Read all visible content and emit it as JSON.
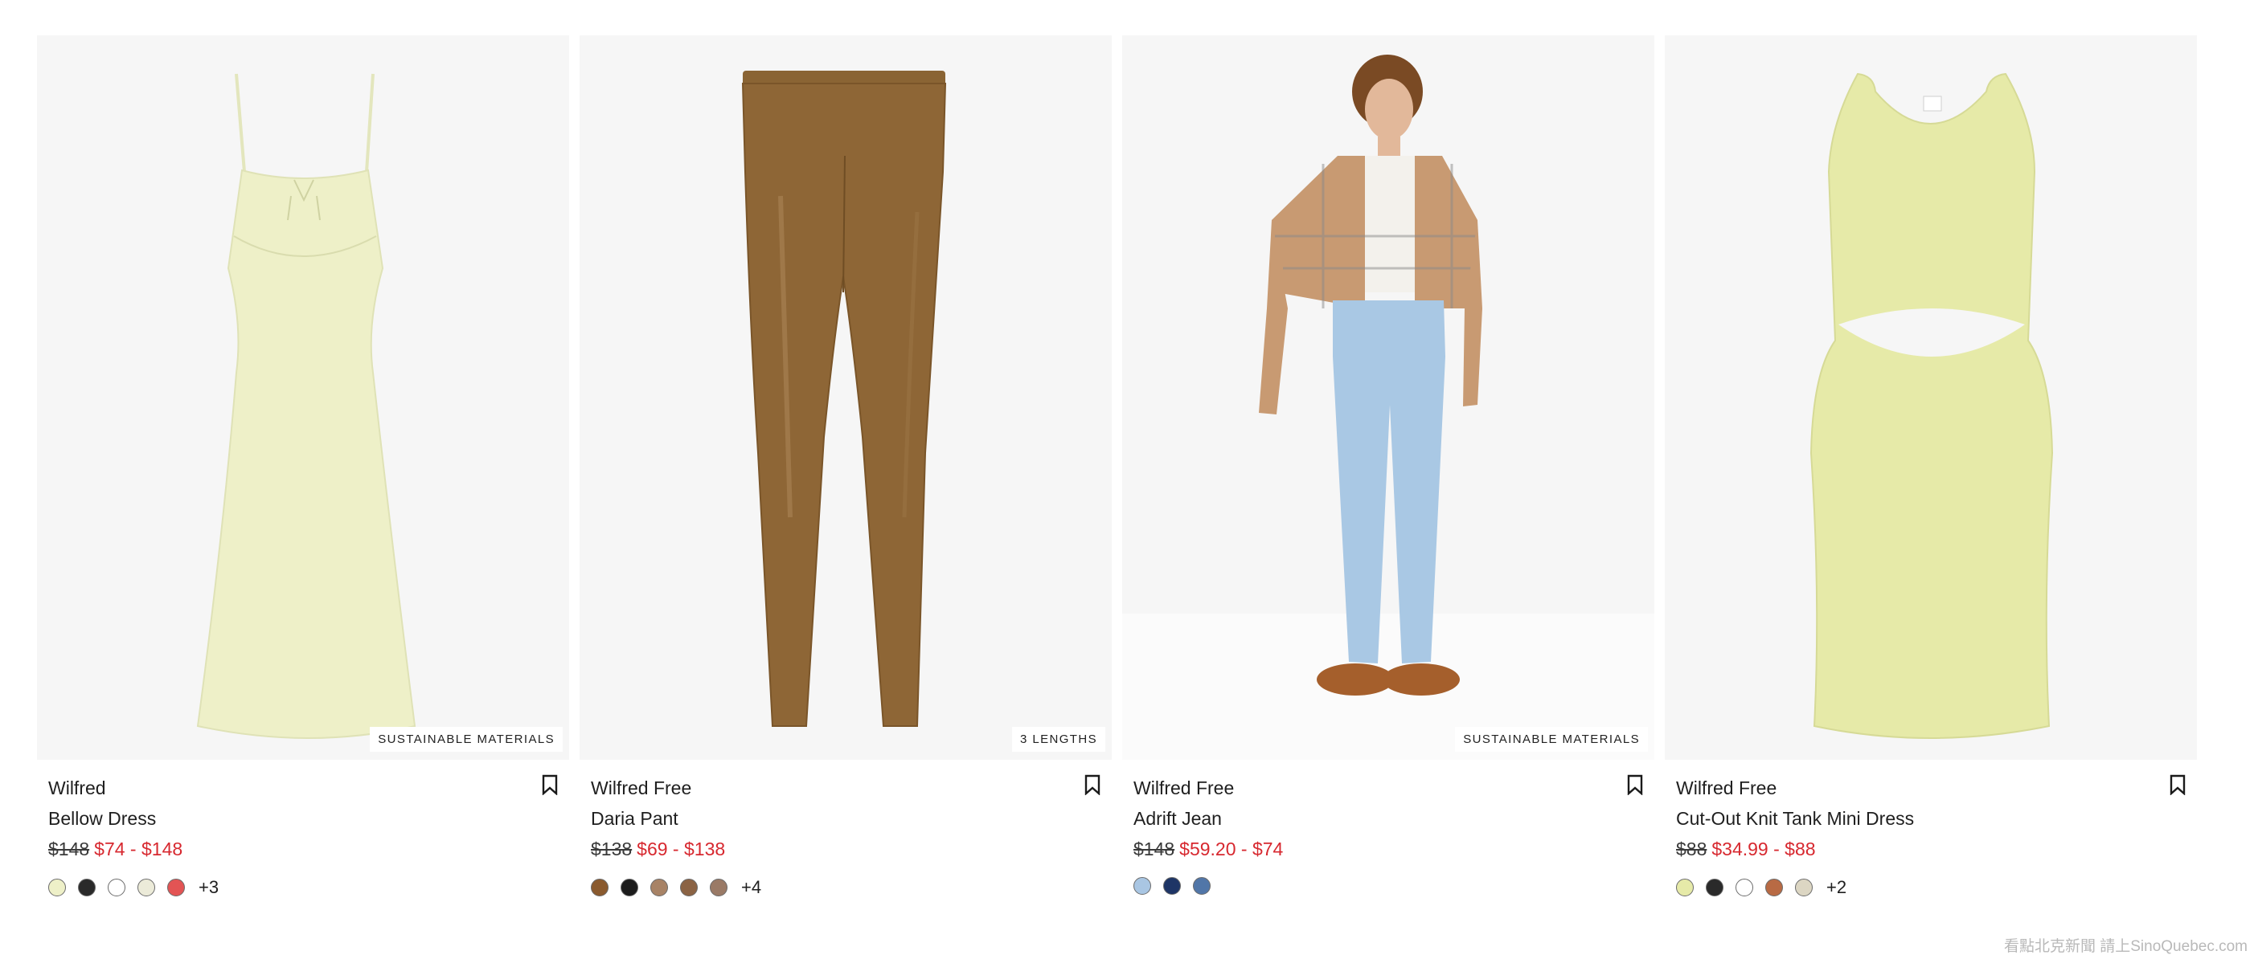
{
  "products": [
    {
      "brand": "Wilfred",
      "name": "Bellow Dress",
      "price_original": "$148",
      "price_sale": "$74 - $148",
      "badge": "SUSTAINABLE MATERIALS",
      "swatches": [
        "#eef0c8",
        "#2a2a2a",
        "#ffffff",
        "#ecebd9",
        "#e35454"
      ],
      "more": "+3",
      "image": "dress-image"
    },
    {
      "brand": "Wilfred Free",
      "name": "Daria Pant",
      "price_original": "$138",
      "price_sale": "$69 - $138",
      "badge": "3 LENGTHS",
      "swatches": [
        "#8a5a2e",
        "#1c1c1c",
        "#a88366",
        "#8b6344",
        "#9a7a66"
      ],
      "more": "+4",
      "image": "pant-image"
    },
    {
      "brand": "Wilfred Free",
      "name": "Adrift Jean",
      "price_original": "$148",
      "price_sale": "$59.20 - $74",
      "badge": "SUSTAINABLE MATERIALS",
      "swatches": [
        "#a9c6e3",
        "#1e3566",
        "#5176a8"
      ],
      "more": "",
      "image": "model-image"
    },
    {
      "brand": "Wilfred Free",
      "name": "Cut-Out Knit Tank Mini Dress",
      "price_original": "$88",
      "price_sale": "$34.99 - $88",
      "badge": "",
      "swatches": [
        "#e6eaa8",
        "#2a2a2a",
        "#ffffff",
        "#b86a44",
        "#dcd6c3"
      ],
      "more": "+2",
      "image": "mini-dress-image"
    }
  ],
  "watermark": "看點北克新聞 請上SinoQuebec.com",
  "colors": {
    "sale": "#d7282f",
    "image_bg": "#f6f6f6"
  }
}
